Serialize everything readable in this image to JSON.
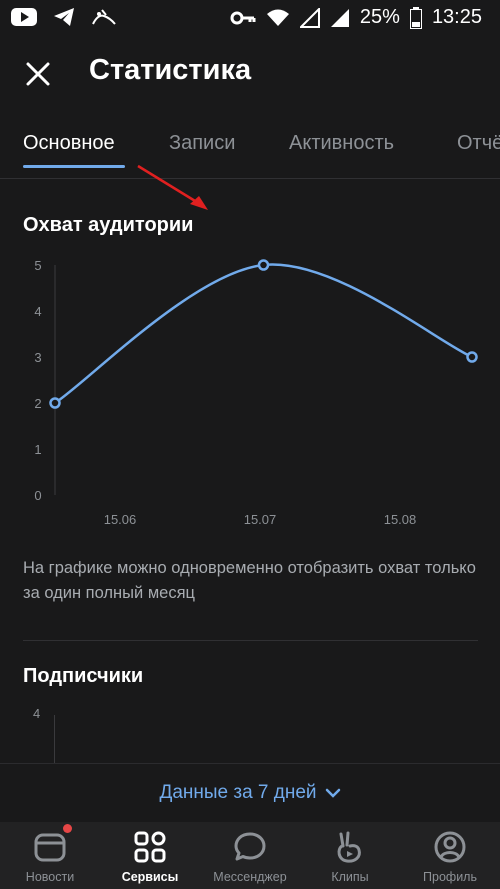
{
  "status_bar": {
    "battery": "25%",
    "time": "13:25"
  },
  "header": {
    "title": "Статистика"
  },
  "tabs": [
    {
      "label": "Основное",
      "active": true
    },
    {
      "label": "Записи",
      "active": false
    },
    {
      "label": "Активность",
      "active": false
    },
    {
      "label": "Отчёты",
      "active": false
    }
  ],
  "reach": {
    "title": "Охват аудитории",
    "note": "На графике можно одновременно отобразить охват только за один полный месяц"
  },
  "subscribers": {
    "title": "Подписчики",
    "y_tick_top": "4"
  },
  "chart_data": {
    "type": "line",
    "title": "Охват аудитории",
    "x_ticks": [
      "15.06",
      "15.07",
      "15.08"
    ],
    "y_ticks": [
      0,
      1,
      2,
      3,
      4,
      5
    ],
    "ylim": [
      0,
      5
    ],
    "series": [
      {
        "values": [
          2,
          5,
          3
        ],
        "color": "#71aaeb"
      }
    ],
    "grid": false
  },
  "range_selector": {
    "label": "Данные за 7 дней"
  },
  "bottom_nav": [
    {
      "label": "Новости",
      "icon": "news-icon",
      "active": false,
      "badge": true
    },
    {
      "label": "Сервисы",
      "icon": "services-icon",
      "active": true,
      "badge": false
    },
    {
      "label": "Мессенджер",
      "icon": "messenger-icon",
      "active": false,
      "badge": false
    },
    {
      "label": "Клипы",
      "icon": "clips-icon",
      "active": false,
      "badge": false
    },
    {
      "label": "Профиль",
      "icon": "profile-icon",
      "active": false,
      "badge": false
    }
  ],
  "colors": {
    "accent": "#71aaeb",
    "background": "#19191a",
    "nav_background": "#222223"
  }
}
